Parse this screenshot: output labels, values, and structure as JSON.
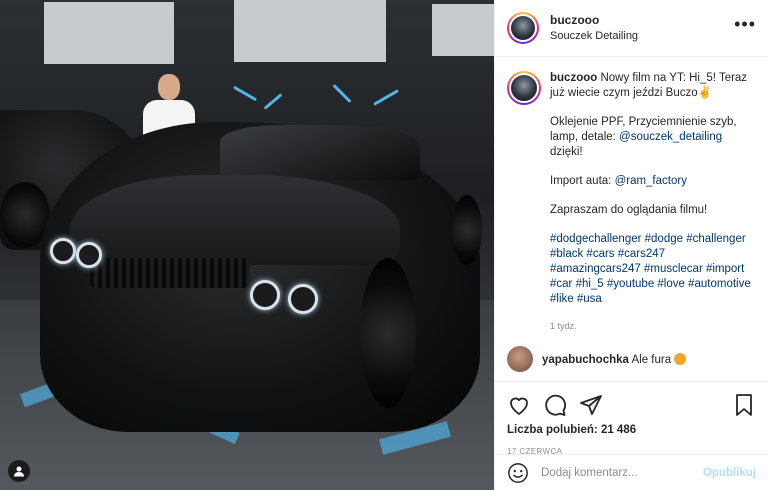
{
  "post": {
    "username": "buczooo",
    "subtitle": "Souczek Detailing"
  },
  "caption": {
    "username": "buczooo",
    "line1": "Nowy film na YT: Hi_5! Teraz już wiecie czym jeździ Buczo",
    "line1_emoji": "✌️",
    "p2_text": "Oklejenie PPF, Przyciemnienie szyb, lamp, detale: ",
    "p2_link": "@souczek_detailing",
    "p2_tail": " dzięki!",
    "p3_text": "Import auta: ",
    "p3_link": "@ram_factory",
    "p4": "Zapraszam do oglądania filmu!",
    "hashtags": "#dodgechallenger #dodge #challenger #black #cars #cars247 #amazingcars247 #musclecar #import #car #hi_5 #youtube #love #automotive #like #usa",
    "age": "1 tydz."
  },
  "next_comment": {
    "username": "yapabuchochka",
    "text": "Ale fura"
  },
  "stats": {
    "likes_label": "Liczba polubień:",
    "likes_count": "21 486",
    "date": "17 CZERWCA"
  },
  "comment_input": {
    "placeholder": "Dodaj komentarz...",
    "publish_label": "Opublikuj"
  },
  "icons": {
    "more": "more-options-icon",
    "like": "heart-icon",
    "comment": "comment-icon",
    "share": "share-icon",
    "save": "bookmark-icon",
    "emoji": "smile-icon",
    "tag": "user-tag-icon"
  },
  "colors": {
    "link": "#00376b",
    "muted": "#8e8e8e",
    "publish_disabled": "#b2dffc",
    "neon_accent": "#52b6e8"
  }
}
